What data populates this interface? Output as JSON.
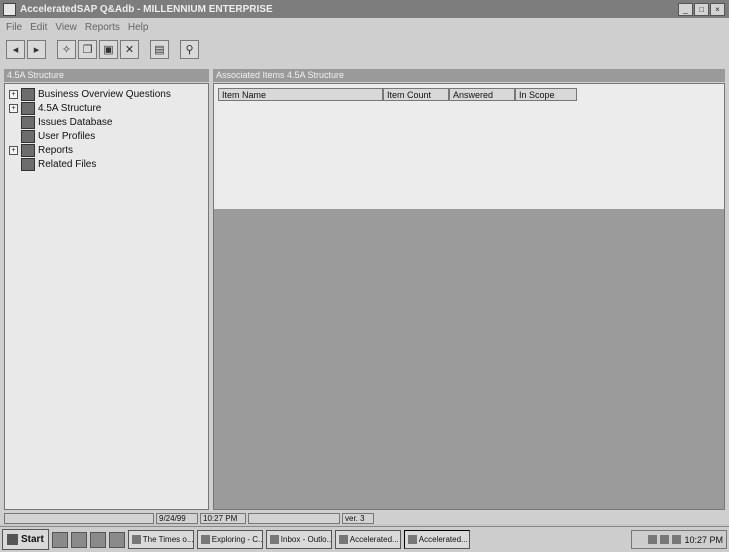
{
  "window": {
    "title": "AcceleratedSAP Q&Adb - MILLENNIUM ENTERPRISE"
  },
  "menu": [
    "File",
    "Edit",
    "View",
    "Reports",
    "Help"
  ],
  "toolbar": {
    "buttons": [
      "back-icon",
      "forward-icon",
      "new-icon",
      "copy-icon",
      "save-icon",
      "delete-icon",
      "properties-icon",
      "find-icon"
    ]
  },
  "left_pane": {
    "header": "4.5A Structure",
    "items": [
      {
        "label": "Business Overview Questions",
        "expandable": true
      },
      {
        "label": "4.5A Structure",
        "expandable": true
      },
      {
        "label": "Issues Database",
        "expandable": false
      },
      {
        "label": "User Profiles",
        "expandable": false
      },
      {
        "label": "Reports",
        "expandable": true
      },
      {
        "label": "Related Files",
        "expandable": false
      }
    ]
  },
  "right_pane": {
    "header": "Associated Items 4.5A Structure",
    "columns": [
      "Item Name",
      "Item Count",
      "Answered",
      "In Scope"
    ]
  },
  "status": {
    "date": "9/24/99",
    "time": "10:27 PM",
    "version": "ver. 3"
  },
  "taskbar": {
    "start_label": "Start",
    "tasks": [
      "The Times o...",
      "Exploring - C...",
      "Inbox - Outlo...",
      "Accelerated...",
      "Accelerated..."
    ],
    "clock": "10:27 PM"
  },
  "colors": {
    "titlebar": "#7d7d7d",
    "panel_header": "#9a9a9a",
    "pane_bg": "#e9e9e9",
    "dark_area": "#9b9b9b"
  }
}
